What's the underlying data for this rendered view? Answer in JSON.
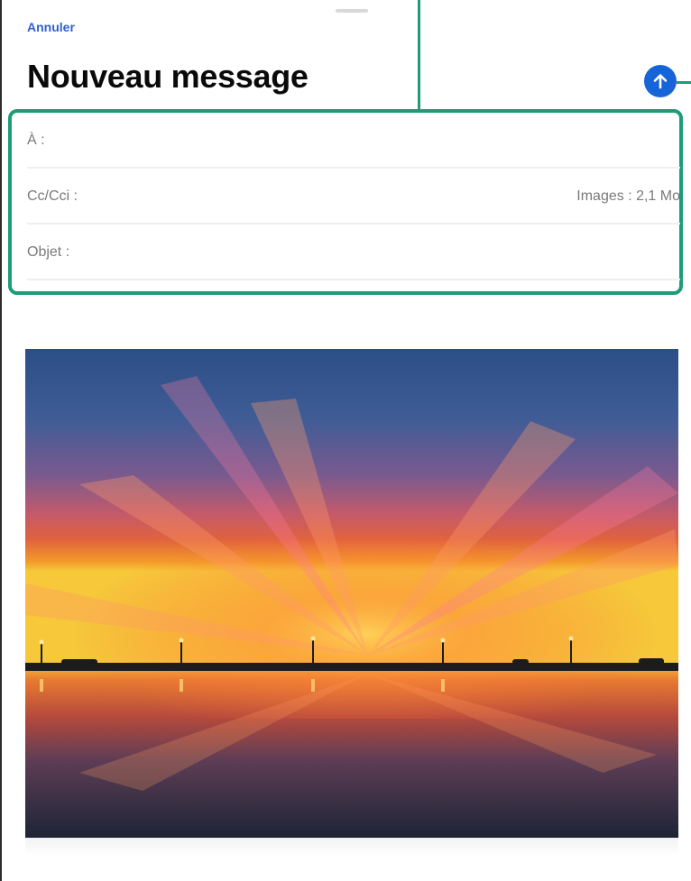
{
  "header": {
    "cancel_label": "Annuler",
    "title": "Nouveau message",
    "send_icon": "arrow-up-circle-icon"
  },
  "fields": {
    "to_label": "À :",
    "cc_label": "Cc/Cci :",
    "cc_meta": "Images : 2,1 Mo",
    "subject_label": "Objet :"
  },
  "attachment": {
    "type": "image",
    "subject": "sunset-over-sea-pier-photo"
  },
  "colors": {
    "accent_link": "#2f5fd0",
    "send_button": "#1565d8",
    "annotation_green": "#1e9c78"
  }
}
